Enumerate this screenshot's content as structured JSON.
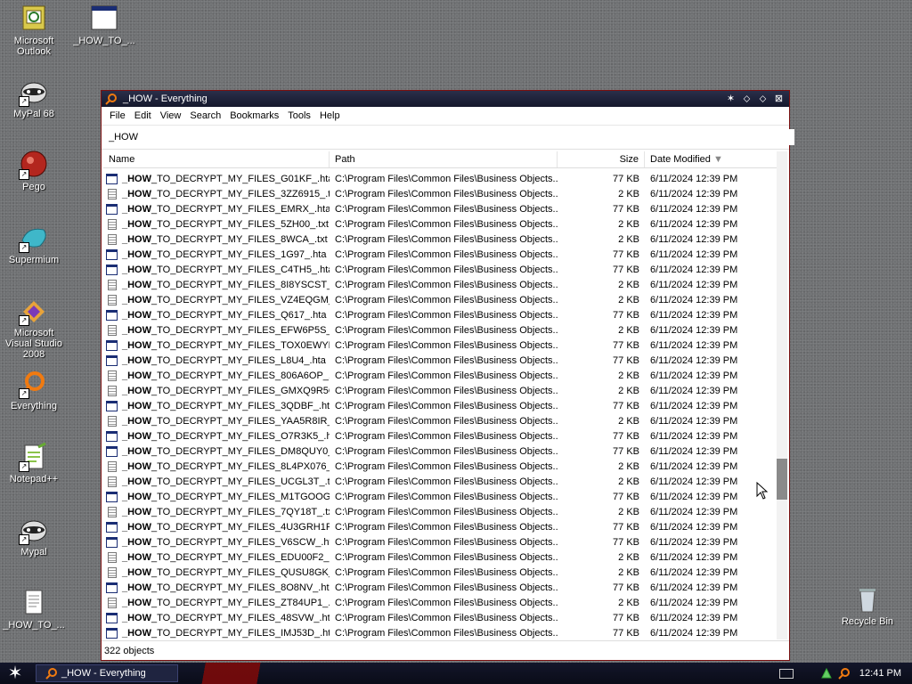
{
  "desktop": {
    "icons": [
      {
        "label": "Microsoft Outlook"
      },
      {
        "label": "_HOW_TO_..."
      },
      {
        "label": "MyPal 68"
      },
      {
        "label": "Pego"
      },
      {
        "label": "Supermium"
      },
      {
        "label": "Microsoft Visual Studio 2008"
      },
      {
        "label": "Everything"
      },
      {
        "label": "Notepad++"
      },
      {
        "label": "Mypal"
      },
      {
        "label": "_HOW_TO_..."
      },
      {
        "label": "Recycle Bin"
      }
    ]
  },
  "window": {
    "title": "_HOW - Everything",
    "menu": [
      "File",
      "Edit",
      "View",
      "Search",
      "Bookmarks",
      "Tools",
      "Help"
    ],
    "search_value": "_HOW",
    "columns": {
      "name": "Name",
      "path": "Path",
      "size": "Size",
      "date": "Date Modified"
    },
    "rows": [
      {
        "name": "_HOW_TO_DECRYPT_MY_FILES_G01KF_.hta",
        "type": "hta",
        "path": "C:\\Program Files\\Common Files\\Business Objects...",
        "size": "77 KB",
        "date": "6/11/2024 12:39 PM"
      },
      {
        "name": "_HOW_TO_DECRYPT_MY_FILES_3ZZ6915_.txt",
        "type": "txt",
        "path": "C:\\Program Files\\Common Files\\Business Objects...",
        "size": "2 KB",
        "date": "6/11/2024 12:39 PM"
      },
      {
        "name": "_HOW_TO_DECRYPT_MY_FILES_EMRX_.hta",
        "type": "hta",
        "path": "C:\\Program Files\\Common Files\\Business Objects...",
        "size": "77 KB",
        "date": "6/11/2024 12:39 PM"
      },
      {
        "name": "_HOW_TO_DECRYPT_MY_FILES_5ZH00_.txt",
        "type": "txt",
        "path": "C:\\Program Files\\Common Files\\Business Objects...",
        "size": "2 KB",
        "date": "6/11/2024 12:39 PM"
      },
      {
        "name": "_HOW_TO_DECRYPT_MY_FILES_8WCA_.txt",
        "type": "txt",
        "path": "C:\\Program Files\\Common Files\\Business Objects...",
        "size": "2 KB",
        "date": "6/11/2024 12:39 PM"
      },
      {
        "name": "_HOW_TO_DECRYPT_MY_FILES_1G97_.hta",
        "type": "hta",
        "path": "C:\\Program Files\\Common Files\\Business Objects...",
        "size": "77 KB",
        "date": "6/11/2024 12:39 PM"
      },
      {
        "name": "_HOW_TO_DECRYPT_MY_FILES_C4TH5_.hta",
        "type": "hta",
        "path": "C:\\Program Files\\Common Files\\Business Objects...",
        "size": "77 KB",
        "date": "6/11/2024 12:39 PM"
      },
      {
        "name": "_HOW_TO_DECRYPT_MY_FILES_8I8YSCST_...",
        "type": "txt",
        "path": "C:\\Program Files\\Common Files\\Business Objects...",
        "size": "2 KB",
        "date": "6/11/2024 12:39 PM"
      },
      {
        "name": "_HOW_TO_DECRYPT_MY_FILES_VZ4EQGM_...",
        "type": "txt",
        "path": "C:\\Program Files\\Common Files\\Business Objects...",
        "size": "2 KB",
        "date": "6/11/2024 12:39 PM"
      },
      {
        "name": "_HOW_TO_DECRYPT_MY_FILES_Q617_.hta",
        "type": "hta",
        "path": "C:\\Program Files\\Common Files\\Business Objects...",
        "size": "77 KB",
        "date": "6/11/2024 12:39 PM"
      },
      {
        "name": "_HOW_TO_DECRYPT_MY_FILES_EFW6P5S_...",
        "type": "txt",
        "path": "C:\\Program Files\\Common Files\\Business Objects...",
        "size": "2 KB",
        "date": "6/11/2024 12:39 PM"
      },
      {
        "name": "_HOW_TO_DECRYPT_MY_FILES_TOX0EWYB...",
        "type": "hta",
        "path": "C:\\Program Files\\Common Files\\Business Objects...",
        "size": "77 KB",
        "date": "6/11/2024 12:39 PM"
      },
      {
        "name": "_HOW_TO_DECRYPT_MY_FILES_L8U4_.hta",
        "type": "hta",
        "path": "C:\\Program Files\\Common Files\\Business Objects...",
        "size": "77 KB",
        "date": "6/11/2024 12:39 PM"
      },
      {
        "name": "_HOW_TO_DECRYPT_MY_FILES_806A6OP_...",
        "type": "txt",
        "path": "C:\\Program Files\\Common Files\\Business Objects...",
        "size": "2 KB",
        "date": "6/11/2024 12:39 PM"
      },
      {
        "name": "_HOW_TO_DECRYPT_MY_FILES_GMXQ9R5Q...",
        "type": "txt",
        "path": "C:\\Program Files\\Common Files\\Business Objects...",
        "size": "2 KB",
        "date": "6/11/2024 12:39 PM"
      },
      {
        "name": "_HOW_TO_DECRYPT_MY_FILES_3QDBF_.hta",
        "type": "hta",
        "path": "C:\\Program Files\\Common Files\\Business Objects...",
        "size": "77 KB",
        "date": "6/11/2024 12:39 PM"
      },
      {
        "name": "_HOW_TO_DECRYPT_MY_FILES_YAA5R8IR_...",
        "type": "txt",
        "path": "C:\\Program Files\\Common Files\\Business Objects...",
        "size": "2 KB",
        "date": "6/11/2024 12:39 PM"
      },
      {
        "name": "_HOW_TO_DECRYPT_MY_FILES_O7R3K5_.hta",
        "type": "hta",
        "path": "C:\\Program Files\\Common Files\\Business Objects...",
        "size": "77 KB",
        "date": "6/11/2024 12:39 PM"
      },
      {
        "name": "_HOW_TO_DECRYPT_MY_FILES_DM8QUY0_...",
        "type": "hta",
        "path": "C:\\Program Files\\Common Files\\Business Objects...",
        "size": "77 KB",
        "date": "6/11/2024 12:39 PM"
      },
      {
        "name": "_HOW_TO_DECRYPT_MY_FILES_8L4PX076_...",
        "type": "txt",
        "path": "C:\\Program Files\\Common Files\\Business Objects...",
        "size": "2 KB",
        "date": "6/11/2024 12:39 PM"
      },
      {
        "name": "_HOW_TO_DECRYPT_MY_FILES_UCGL3T_.txt",
        "type": "txt",
        "path": "C:\\Program Files\\Common Files\\Business Objects...",
        "size": "2 KB",
        "date": "6/11/2024 12:39 PM"
      },
      {
        "name": "_HOW_TO_DECRYPT_MY_FILES_M1TGOOG0...",
        "type": "hta",
        "path": "C:\\Program Files\\Common Files\\Business Objects...",
        "size": "77 KB",
        "date": "6/11/2024 12:39 PM"
      },
      {
        "name": "_HOW_TO_DECRYPT_MY_FILES_7QY18T_.txt",
        "type": "txt",
        "path": "C:\\Program Files\\Common Files\\Business Objects...",
        "size": "2 KB",
        "date": "6/11/2024 12:39 PM"
      },
      {
        "name": "_HOW_TO_DECRYPT_MY_FILES_4U3GRH1F...",
        "type": "hta",
        "path": "C:\\Program Files\\Common Files\\Business Objects...",
        "size": "77 KB",
        "date": "6/11/2024 12:39 PM"
      },
      {
        "name": "_HOW_TO_DECRYPT_MY_FILES_V6SCW_.hta",
        "type": "hta",
        "path": "C:\\Program Files\\Common Files\\Business Objects...",
        "size": "77 KB",
        "date": "6/11/2024 12:39 PM"
      },
      {
        "name": "_HOW_TO_DECRYPT_MY_FILES_EDU00F2_.txt",
        "type": "txt",
        "path": "C:\\Program Files\\Common Files\\Business Objects...",
        "size": "2 KB",
        "date": "6/11/2024 12:39 PM"
      },
      {
        "name": "_HOW_TO_DECRYPT_MY_FILES_QUSU8GK_...",
        "type": "txt",
        "path": "C:\\Program Files\\Common Files\\Business Objects...",
        "size": "2 KB",
        "date": "6/11/2024 12:39 PM"
      },
      {
        "name": "_HOW_TO_DECRYPT_MY_FILES_8O8NV_.hta",
        "type": "hta",
        "path": "C:\\Program Files\\Common Files\\Business Objects...",
        "size": "77 KB",
        "date": "6/11/2024 12:39 PM"
      },
      {
        "name": "_HOW_TO_DECRYPT_MY_FILES_ZT84UP1_.txt",
        "type": "txt",
        "path": "C:\\Program Files\\Common Files\\Business Objects...",
        "size": "2 KB",
        "date": "6/11/2024 12:39 PM"
      },
      {
        "name": "_HOW_TO_DECRYPT_MY_FILES_48SVW_.hta",
        "type": "hta",
        "path": "C:\\Program Files\\Common Files\\Business Objects...",
        "size": "77 KB",
        "date": "6/11/2024 12:39 PM"
      },
      {
        "name": "_HOW_TO_DECRYPT_MY_FILES_IMJ53D_.hta",
        "type": "hta",
        "path": "C:\\Program Files\\Common Files\\Business Objects...",
        "size": "77 KB",
        "date": "6/11/2024 12:39 PM"
      }
    ],
    "status": "322 objects"
  },
  "taskbar": {
    "task_label": "_HOW - Everything",
    "clock": "12:41 PM"
  },
  "colors": {
    "titlebar": "#15182c",
    "window_border": "#7a1010",
    "hta_icon": "#1a2d74",
    "taskbar": "#0a0c18"
  }
}
